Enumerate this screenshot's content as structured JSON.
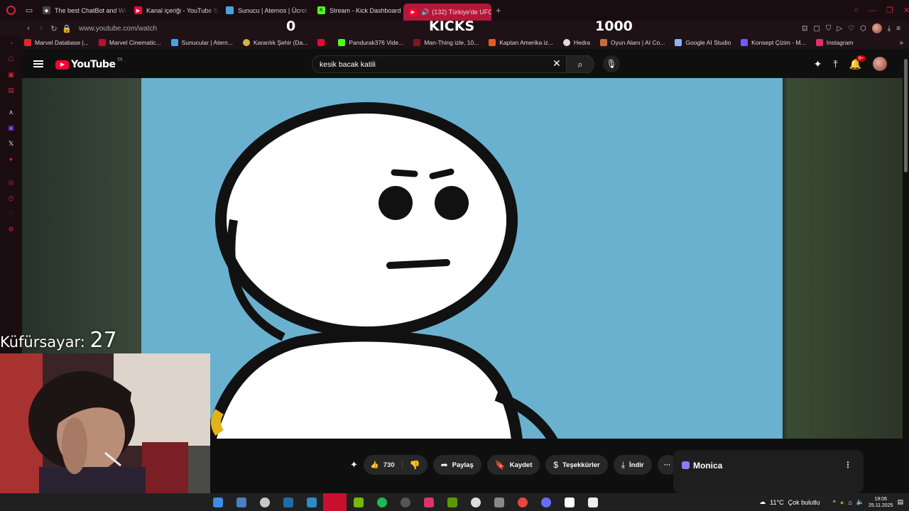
{
  "tabs": [
    {
      "label": "The best ChatBot and Wi",
      "fav_color": "#ffffff",
      "active": false
    },
    {
      "label": "Kanal içeriği - YouTube S",
      "fav_color": "#ff0033",
      "active": false
    },
    {
      "label": "Sunucu | Aternos | Ücret",
      "fav_color": "#4aa3df",
      "active": false
    },
    {
      "label": "Stream - Kick Dashboard",
      "fav_color": "#53fc18",
      "active": false
    },
    {
      "label": "(132) Türkiye'de UFO",
      "fav_color": "#ff0033",
      "active": true
    }
  ],
  "address": {
    "url": "www.youtube.com/watch"
  },
  "kick_overlay": {
    "left": "0",
    "center": "KICKS",
    "right": "1000"
  },
  "bookmarks": [
    {
      "label": "Marvel Database |...",
      "color": "#e62429"
    },
    {
      "label": "Marvel Cinematic...",
      "color": "#b0162b"
    },
    {
      "label": "Sunucular | Atern...",
      "color": "#4aa3df"
    },
    {
      "label": "Karanlık Şehir (Da...",
      "color": "#d6b24a"
    },
    {
      "label": "",
      "color": "#ff0033"
    },
    {
      "label": "Pandurak376 Vide...",
      "color": "#53fc18"
    },
    {
      "label": "Man-Thing izle, 10...",
      "color": "#7a1a1a"
    },
    {
      "label": "Kaptan Amerika iz...",
      "color": "#e06020"
    },
    {
      "label": "Hedra",
      "color": "#dddddd"
    },
    {
      "label": "Oyun Alanı | AI Co...",
      "color": "#c07040"
    },
    {
      "label": "Google AI Studio",
      "color": "#8ab4f8"
    },
    {
      "label": "Konsept Çizim - M...",
      "color": "#6f5bff"
    },
    {
      "label": "Instagram",
      "color": "#e1306c"
    }
  ],
  "youtube": {
    "logo": "YouTube",
    "region": "TR",
    "search_query": "kesik bacak katili",
    "notif_count": "9+"
  },
  "actions": {
    "likes": "730",
    "share": "Paylaş",
    "save": "Kaydet",
    "thanks": "Teşekkürler",
    "download": "İndir"
  },
  "monica": {
    "title": "Monica"
  },
  "overlay": {
    "kufur_label": "Küfürsayar:",
    "kufur_count": "27"
  },
  "tray": {
    "temp": "11°C",
    "weather": "Çok bulutlu",
    "time": "19:06",
    "date": "25.11.2025"
  },
  "colors": {
    "accent": "#b5173a",
    "video_bg": "#6ab1cf",
    "yt_red": "#ff0033"
  }
}
